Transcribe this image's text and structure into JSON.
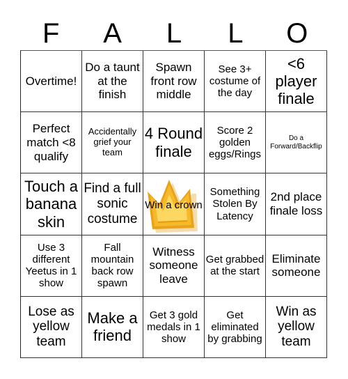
{
  "title_letters": [
    "F",
    "A",
    "L",
    "L",
    "O"
  ],
  "colors": {
    "crown_fill": "#f5b92a",
    "crown_inner": "#fdd860",
    "crown_edge": "#e59a12",
    "grid_line": "#333333"
  },
  "cells": [
    [
      "Overtime!",
      "Do a taunt at the finish",
      "Spawn front row middle",
      "See 3+ costume of the day",
      "<6 player finale"
    ],
    [
      "Perfect match <8 qualify",
      "Accidentally grief your team",
      "4 Round finale",
      "Score 2 golden eggs/Rings",
      "Do a Forward/Backflip"
    ],
    [
      "Touch a banana skin",
      "Find a full sonic costume",
      "Win a crown",
      "Something Stolen By Latency",
      "2nd place finale loss"
    ],
    [
      "Use 3 different Yeetus in 1 show",
      "Fall mountain back row spawn",
      "Witness someone leave",
      "Get grabbed at the start",
      "Eliminate someone"
    ],
    [
      "Lose as yellow team",
      "Make a friend",
      "Get 3 gold medals in 1 show",
      "Get eliminated by grabbing",
      "Win as yellow team"
    ]
  ],
  "free_space_icon": "crown-icon"
}
